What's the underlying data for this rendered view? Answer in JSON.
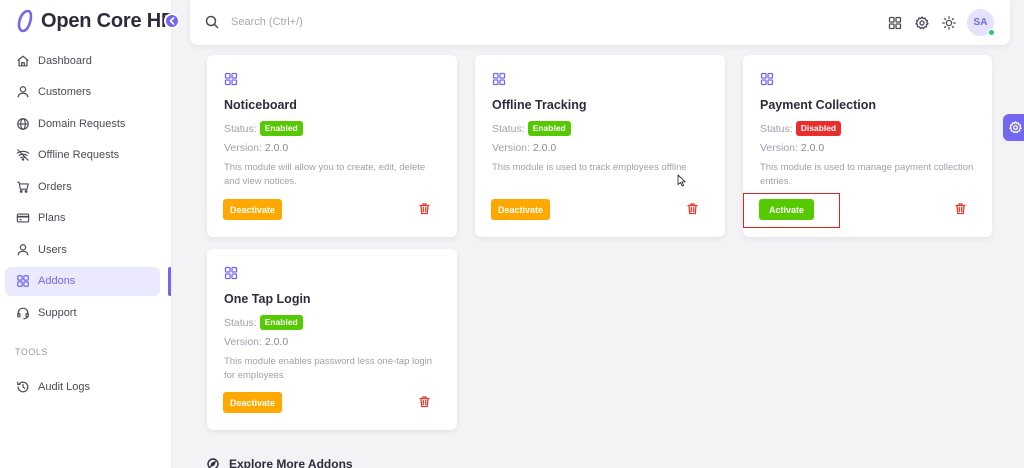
{
  "app": {
    "brand": "Open Core HR",
    "accent_color": "#7367f0"
  },
  "sidebar": {
    "items": [
      {
        "label": "Dashboard",
        "icon": "home-icon"
      },
      {
        "label": "Customers",
        "icon": "user-icon"
      },
      {
        "label": "Domain Requests",
        "icon": "globe-icon"
      },
      {
        "label": "Offline Requests",
        "icon": "wifi-off-icon"
      },
      {
        "label": "Orders",
        "icon": "cart-icon"
      },
      {
        "label": "Plans",
        "icon": "credit-card-icon"
      },
      {
        "label": "Users",
        "icon": "user-icon"
      },
      {
        "label": "Addons",
        "icon": "grid-icon",
        "active": true
      },
      {
        "label": "Support",
        "icon": "headset-icon"
      }
    ],
    "section_label": "TOOLS",
    "tools_items": [
      {
        "label": "Audit Logs",
        "icon": "history-icon"
      }
    ]
  },
  "topbar": {
    "search_placeholder": "Search (Ctrl+/)",
    "avatar_initials": "SA"
  },
  "cards": [
    {
      "title": "Noticeboard",
      "status_label": "Status:",
      "status": "Enabled",
      "version_label": "Version:",
      "version": "2.0.0",
      "description": "This module will allow you to create, edit, delete and view notices.",
      "action": "Deactivate"
    },
    {
      "title": "Offline Tracking",
      "status_label": "Status:",
      "status": "Enabled",
      "version_label": "Version:",
      "version": "2.0.0",
      "description": "This module is used to track employees offline",
      "action": "Deactivate"
    },
    {
      "title": "Payment Collection",
      "status_label": "Status:",
      "status": "Disabled",
      "version_label": "Version:",
      "version": "2.0.0",
      "description": "This module is used to manage payment collection entries.",
      "action": "Activate"
    },
    {
      "title": "One Tap Login",
      "status_label": "Status:",
      "status": "Enabled",
      "version_label": "Version:",
      "version": "2.0.0",
      "description": "This module enables password less one-tap login for employees",
      "action": "Deactivate"
    }
  ],
  "explore": {
    "label": "Explore More Addons"
  },
  "colors": {
    "enabled": "#56ca00",
    "disabled": "#ea2d2d",
    "deactivate": "#ffa800",
    "activate": "#56ca00",
    "trash": "#e8382f"
  }
}
